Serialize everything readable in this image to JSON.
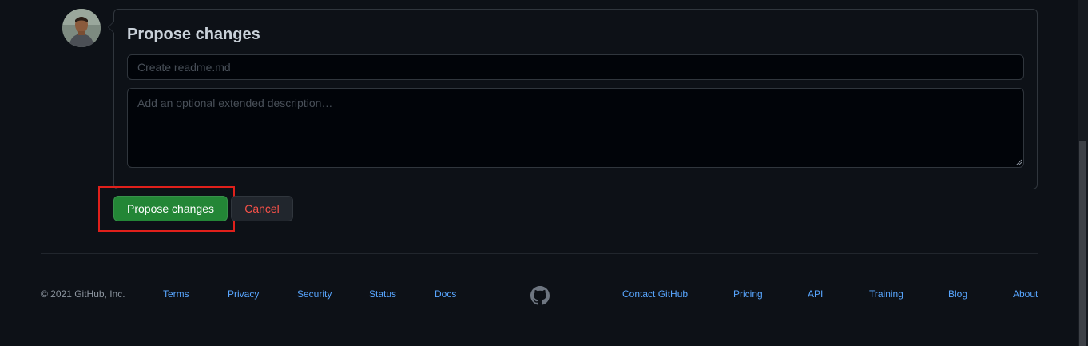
{
  "commit_form": {
    "title": "Propose changes",
    "summary_placeholder": "Create readme.md",
    "description_placeholder": "Add an optional extended description…",
    "propose_button": "Propose changes",
    "cancel_button": "Cancel"
  },
  "footer": {
    "copyright": "© 2021 GitHub, Inc.",
    "left_links": [
      "Terms",
      "Privacy",
      "Security",
      "Status",
      "Docs"
    ],
    "right_links": [
      "Contact GitHub",
      "Pricing",
      "API",
      "Training",
      "Blog",
      "About"
    ]
  },
  "icons": {
    "avatar": "user-avatar",
    "logo": "github-mark-icon"
  },
  "colors": {
    "background": "#0d1117",
    "primary_button": "#238636",
    "danger_text": "#f85149",
    "link": "#58a6ff",
    "highlight": "#e0201b"
  }
}
